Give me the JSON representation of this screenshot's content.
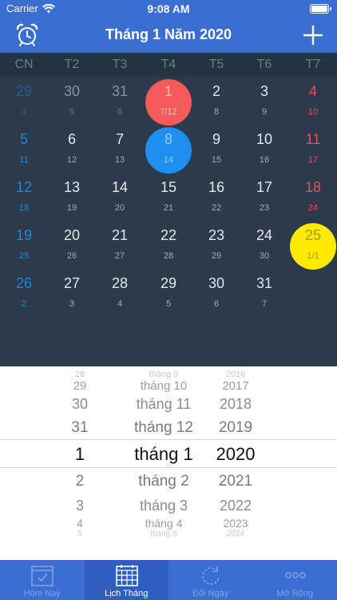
{
  "status": {
    "carrier": "Carrier",
    "time": "9:08 AM"
  },
  "header": {
    "title": "Tháng 1 Năm 2020"
  },
  "weekdays": [
    "CN",
    "T2",
    "T3",
    "T4",
    "T5",
    "T6",
    "T7"
  ],
  "calendar": {
    "rows": [
      [
        {
          "s": "29",
          "l": "4",
          "m": true
        },
        {
          "s": "30",
          "l": "5",
          "m": true
        },
        {
          "s": "31",
          "l": "6",
          "m": true
        },
        {
          "s": "1",
          "l": "7/12",
          "today": true
        },
        {
          "s": "2",
          "l": "8"
        },
        {
          "s": "3",
          "l": "9"
        },
        {
          "s": "4",
          "l": "10"
        }
      ],
      [
        {
          "s": "5",
          "l": "11"
        },
        {
          "s": "6",
          "l": "12"
        },
        {
          "s": "7",
          "l": "13"
        },
        {
          "s": "8",
          "l": "14",
          "sel": true
        },
        {
          "s": "9",
          "l": "15"
        },
        {
          "s": "10",
          "l": "16"
        },
        {
          "s": "11",
          "l": "17"
        }
      ],
      [
        {
          "s": "12",
          "l": "18"
        },
        {
          "s": "13",
          "l": "19"
        },
        {
          "s": "14",
          "l": "20"
        },
        {
          "s": "15",
          "l": "21"
        },
        {
          "s": "16",
          "l": "22"
        },
        {
          "s": "17",
          "l": "23"
        },
        {
          "s": "18",
          "l": "24"
        }
      ],
      [
        {
          "s": "19",
          "l": "25"
        },
        {
          "s": "20",
          "l": "26"
        },
        {
          "s": "21",
          "l": "27"
        },
        {
          "s": "22",
          "l": "28"
        },
        {
          "s": "23",
          "l": "29"
        },
        {
          "s": "24",
          "l": "30"
        },
        {
          "s": "25",
          "l": "1/1",
          "holiday": true
        }
      ],
      [
        {
          "s": "26",
          "l": "2"
        },
        {
          "s": "27",
          "l": "3"
        },
        {
          "s": "28",
          "l": "4"
        },
        {
          "s": "29",
          "l": "5"
        },
        {
          "s": "30",
          "l": "6"
        },
        {
          "s": "31",
          "l": "7"
        },
        {
          "s": "",
          "l": ""
        }
      ]
    ]
  },
  "picker": {
    "rows": [
      {
        "day": "28",
        "month": "tháng 9",
        "year": "2016"
      },
      {
        "day": "29",
        "month": "tháng 10",
        "year": "2017"
      },
      {
        "day": "30",
        "month": "tháng 11",
        "year": "2018"
      },
      {
        "day": "31",
        "month": "tháng 12",
        "year": "2019"
      },
      {
        "day": "1",
        "month": "tháng 1",
        "year": "2020"
      },
      {
        "day": "2",
        "month": "tháng 2",
        "year": "2021"
      },
      {
        "day": "3",
        "month": "tháng 3",
        "year": "2022"
      },
      {
        "day": "4",
        "month": "tháng 4",
        "year": "2023"
      },
      {
        "day": "5",
        "month": "tháng 5",
        "year": "2024"
      }
    ]
  },
  "tabs": [
    {
      "label": "Hôm Nay",
      "icon": "calendar-check-icon"
    },
    {
      "label": "Lịch Tháng",
      "icon": "calendar-grid-icon",
      "active": true
    },
    {
      "label": "Đổi Ngày",
      "icon": "refresh-icon"
    },
    {
      "label": "Mở Rộng",
      "icon": "more-dots-icon"
    }
  ],
  "colors": {
    "header": "#3a6fd1",
    "calendar_bg": "#2c3a4b",
    "today": "#f65a5a",
    "selected": "#1e8ff0",
    "holiday": "#ffea00",
    "sunday": "#1e88d8",
    "saturday": "#e7505a"
  }
}
